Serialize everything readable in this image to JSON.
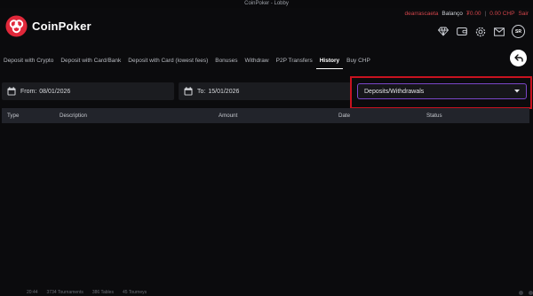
{
  "window": {
    "title": "CoinPoker - Lobby"
  },
  "brand": {
    "name": "CoinPoker",
    "accent": "#e0283a"
  },
  "user": {
    "username": "dearrascaeta",
    "balance_label": "Balanço",
    "balance_value": "₮0.00",
    "separator": "|",
    "chp_value": "0.00 CHP",
    "logout_label": "Sair",
    "avatar_initials": "SR"
  },
  "header_icons": [
    "diamond-icon",
    "wallet-icon",
    "settings-icon",
    "mail-icon",
    "avatar"
  ],
  "tabs": [
    {
      "label": "Deposit with Crypto"
    },
    {
      "label": "Deposit with Card/Bank"
    },
    {
      "label": "Deposit with Card (lowest fees)"
    },
    {
      "label": "Bonuses"
    },
    {
      "label": "Withdraw"
    },
    {
      "label": "P2P Transfers"
    },
    {
      "label": "History",
      "active": true
    },
    {
      "label": "Buy CHP"
    }
  ],
  "filters": {
    "from_label": "From:",
    "from_value": "08/01/2026",
    "to_label": "To:",
    "to_value": "15/01/2026",
    "type_selected": "Deposits/Withdrawals"
  },
  "table": {
    "columns": [
      "Type",
      "Description",
      "Amount",
      "Date",
      "Status"
    ]
  },
  "statusbar": {
    "time": "20:44",
    "item1": "3734 Tournaments",
    "item2": "386 Tables",
    "item3": "45 Tourneys"
  }
}
